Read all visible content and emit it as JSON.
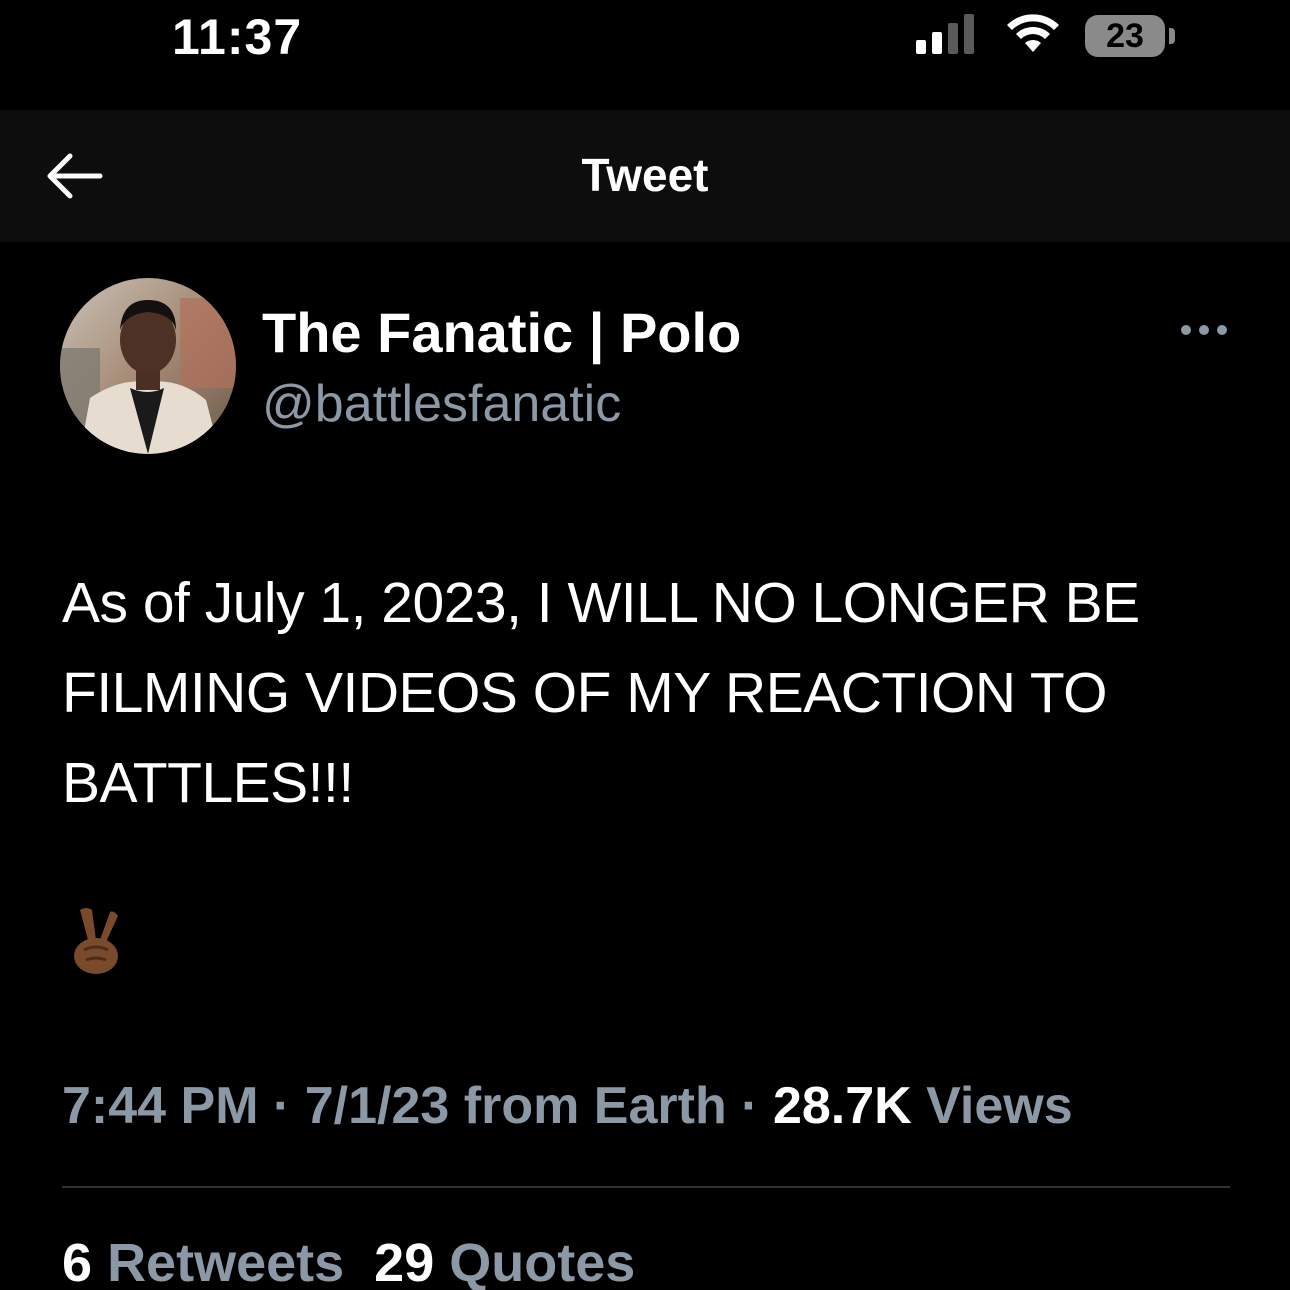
{
  "status_bar": {
    "time": "11:37",
    "battery_level": "23",
    "signal_bars_active": 2,
    "signal_bars_total": 4
  },
  "header": {
    "title": "Tweet",
    "back_icon": "arrow-left-icon"
  },
  "author": {
    "display_name": "The Fanatic | Polo",
    "handle": "@battlesfanatic",
    "more_icon": "ellipsis-icon"
  },
  "tweet": {
    "text": "As of July 1, 2023, I WILL NO LONGER BE FILMING VIDEOS OF MY REACTION TO BATTLES!!!",
    "emoji": "✌🏾"
  },
  "meta": {
    "time": "7:44 PM",
    "separator": "·",
    "date_source": "7/1/23 from Earth",
    "views_count": "28.7K",
    "views_label": "Views"
  },
  "stats": {
    "retweets_count": "6",
    "retweets_label": "Retweets",
    "quotes_count": "29",
    "quotes_label": "Quotes"
  },
  "colors": {
    "background": "#000000",
    "header_background": "#0d0d0d",
    "primary_text": "#ffffff",
    "secondary_text": "#8b98a5",
    "divider": "#2f3336"
  }
}
